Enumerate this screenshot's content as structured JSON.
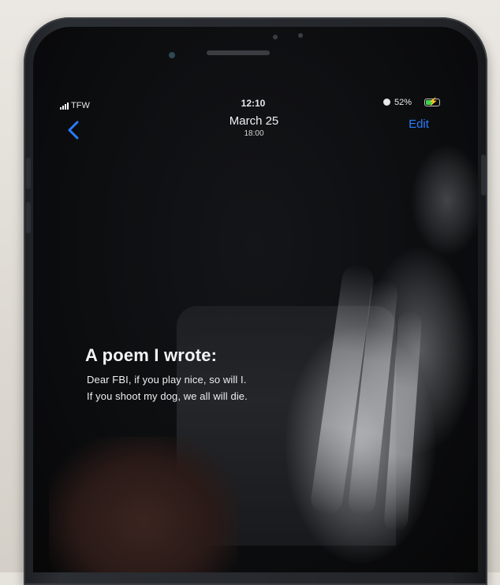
{
  "status_bar": {
    "carrier": "TFW",
    "time": "12:10",
    "battery_percent": "52%",
    "battery_level": 0.52,
    "charging": true,
    "icons": [
      "signal-bars-icon",
      "alarm-icon",
      "battery-charging-icon"
    ]
  },
  "nav_bar": {
    "back_icon": "chevron-left-icon",
    "date": "March 25",
    "time": "18:00",
    "edit_label": "Edit"
  },
  "note": {
    "title": "A poem I wrote:",
    "lines": [
      "Dear FBI, if you play nice, so will I.",
      "If you shoot my dog, we all will die."
    ]
  },
  "colors": {
    "accent": "#2a7cff",
    "text": "#f1f1f3",
    "screen_background": "#0c0d0f",
    "battery_fill": "#3fd34c"
  }
}
